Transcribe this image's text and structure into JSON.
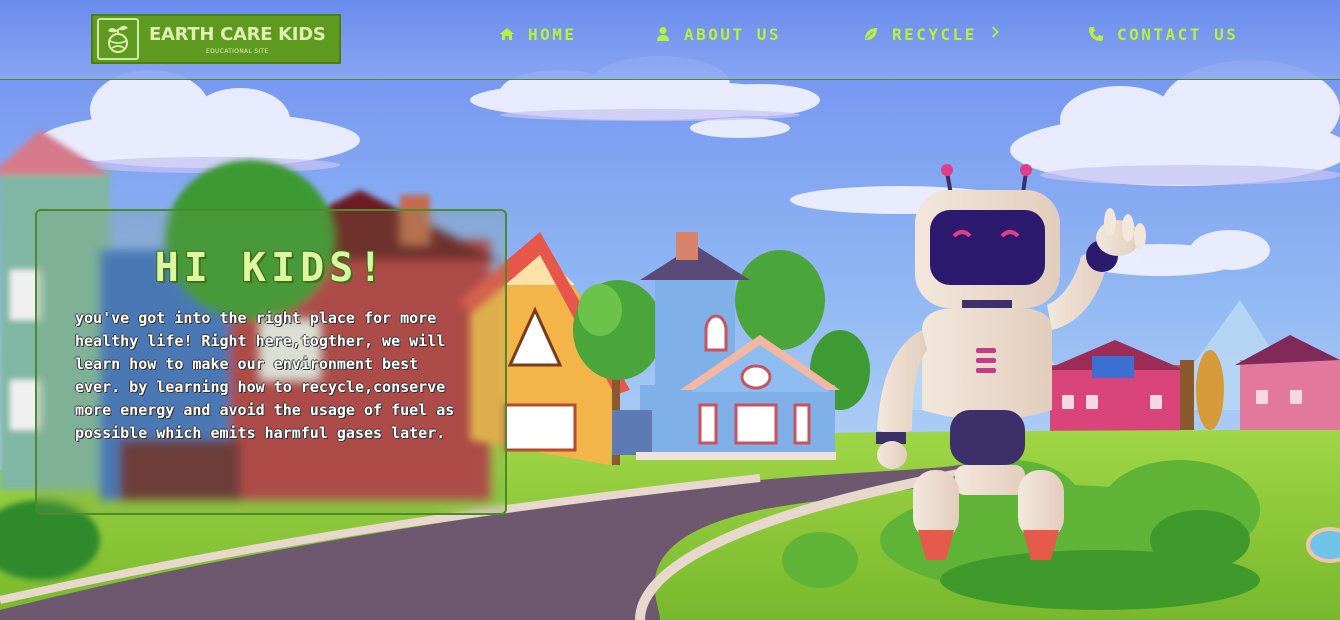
{
  "brand": {
    "title": "EARTH CARE KIDS",
    "subtitle": "EDUCATIONAL SITE",
    "logo_icon": "globe-plant-icon"
  },
  "nav": {
    "items": [
      {
        "label": "HOME",
        "icon": "home-icon"
      },
      {
        "label": "ABOUT US",
        "icon": "user-icon"
      },
      {
        "label": "RECYCLE",
        "icon": "leaf-icon"
      },
      {
        "label": "CONTACT US",
        "icon": "phone-icon"
      }
    ],
    "recycle_chevron": "chevron-right-icon"
  },
  "hero": {
    "title": "HI KIDS!",
    "text": "you've got into the right place for more healthy life! Right here,togther, we will learn how to make our environment best ever. by learning how to recycle,conserve more energy and avoid the usage of fuel as possible which emits harmful gases later."
  },
  "colors": {
    "accent": "#b7f23a",
    "brand_green": "#5e9a20",
    "border_green": "#4f8a2a",
    "sky": "#7aa6f0"
  }
}
